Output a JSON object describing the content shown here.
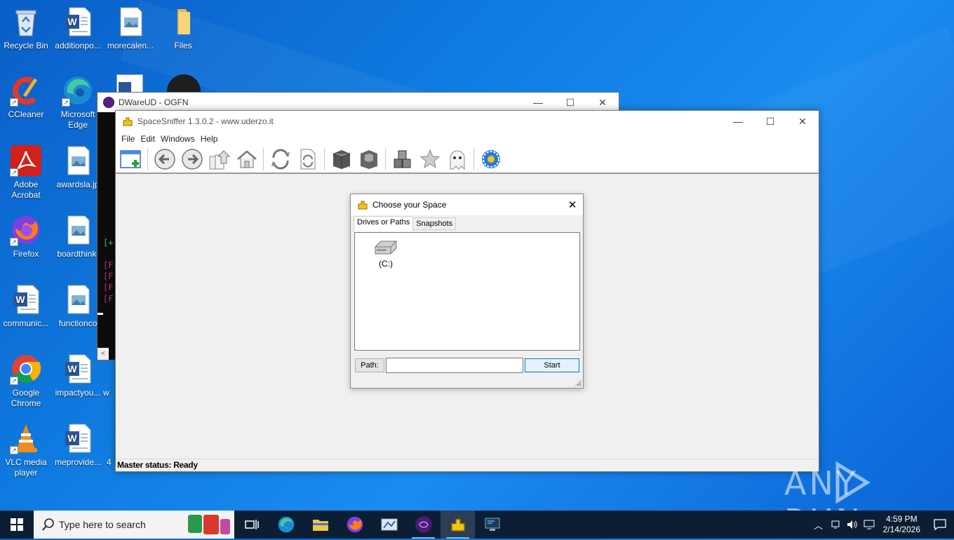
{
  "desktop": {
    "icons": [
      {
        "label": "Recycle Bin"
      },
      {
        "label": "additionpo..."
      },
      {
        "label": "morecalen..."
      },
      {
        "label": "Files"
      },
      {
        "label": "CCleaner"
      },
      {
        "label": "Microsoft Edge"
      },
      {
        "label": "Adobe Acrobat"
      },
      {
        "label": "awardsla.jp"
      },
      {
        "label": "Firefox"
      },
      {
        "label": "boardthink."
      },
      {
        "label": "communic..."
      },
      {
        "label": "functionco"
      },
      {
        "label": "Google Chrome"
      },
      {
        "label": "impactyou..."
      },
      {
        "label": "w"
      },
      {
        "label": "VLC media player"
      },
      {
        "label": "meprovide..."
      },
      {
        "label": "4"
      }
    ]
  },
  "console_window": {
    "title": "DWareUD - OGFN",
    "glyph_lines": [
      "[+",
      "[F",
      "[F",
      "[F",
      "[F"
    ]
  },
  "main_window": {
    "title": "SpaceSniffer 1.3.0.2 - www.uderzo.it",
    "menu": [
      "File",
      "Edit",
      "Windows",
      "Help"
    ],
    "status": "Master status: Ready"
  },
  "dialog": {
    "title": "Choose your Space",
    "tabs": [
      "Drives or Paths",
      "Snapshots"
    ],
    "drive_label": "(C:)",
    "path_label": "Path:",
    "path_value": "",
    "start_label": "Start"
  },
  "taskbar": {
    "search_placeholder": "Type here to search",
    "time": "4:59 PM",
    "date": "2/14/2026"
  },
  "watermark": "ANY RUN"
}
